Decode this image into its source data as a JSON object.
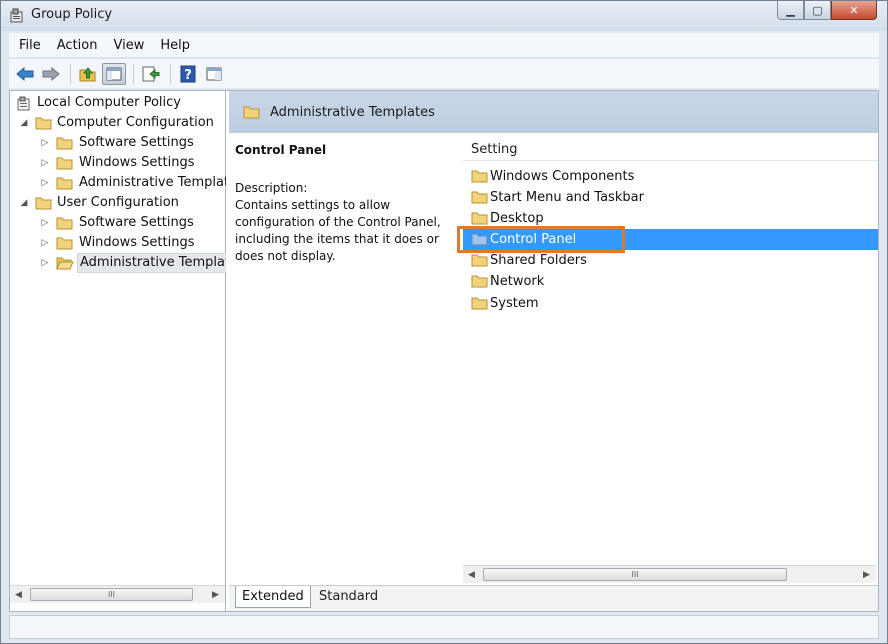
{
  "window": {
    "title": "Group Policy"
  },
  "menu": {
    "items": [
      "File",
      "Action",
      "View",
      "Help"
    ]
  },
  "tree": {
    "items": [
      {
        "label": "Local Computer Policy",
        "level": 0,
        "toggle": "",
        "icon": "policy"
      },
      {
        "label": "Computer Configuration",
        "level": 1,
        "toggle": "expanded",
        "icon": "folder"
      },
      {
        "label": "Software Settings",
        "level": 2,
        "toggle": "collapsed",
        "icon": "folder"
      },
      {
        "label": "Windows Settings",
        "level": 2,
        "toggle": "collapsed",
        "icon": "folder"
      },
      {
        "label": "Administrative Template",
        "level": 2,
        "toggle": "collapsed",
        "icon": "folder"
      },
      {
        "label": "User Configuration",
        "level": 1,
        "toggle": "expanded",
        "icon": "folder"
      },
      {
        "label": "Software Settings",
        "level": 2,
        "toggle": "collapsed",
        "icon": "folder"
      },
      {
        "label": "Windows Settings",
        "level": 2,
        "toggle": "collapsed",
        "icon": "folder"
      },
      {
        "label": "Administrative Template",
        "level": 2,
        "toggle": "collapsed",
        "icon": "folder-open",
        "selected": true
      }
    ]
  },
  "right_pane": {
    "header": "Administrative Templates",
    "extended": {
      "title": "Control Panel",
      "description_label": "Description:",
      "description": "Contains settings to allow configuration of the Control Panel, including the items that it does or does not display."
    },
    "column_header": "Setting",
    "items": [
      {
        "label": "Windows Components"
      },
      {
        "label": "Start Menu and Taskbar"
      },
      {
        "label": "Desktop"
      },
      {
        "label": "Control Panel",
        "selected": true
      },
      {
        "label": "Shared Folders"
      },
      {
        "label": "Network"
      },
      {
        "label": "System"
      }
    ],
    "tabs": [
      "Extended",
      "Standard"
    ]
  },
  "colors": {
    "selection": "#3399ff",
    "highlight": "#e07a2b",
    "header": "#c9d6e6"
  }
}
